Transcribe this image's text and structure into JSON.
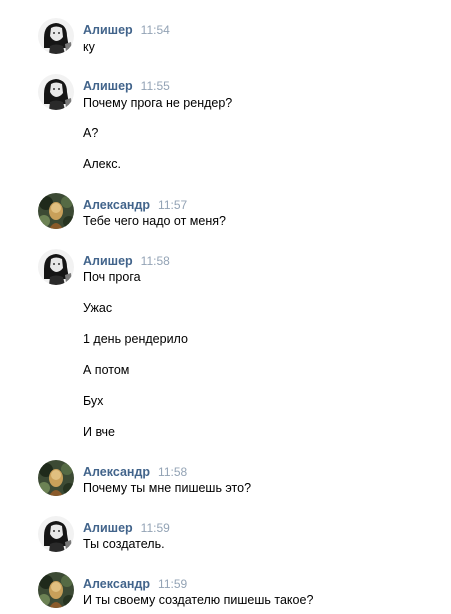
{
  "messages": [
    {
      "author": "Алишер",
      "time": "11:54",
      "avatar": "alisher",
      "lines": [
        "ку"
      ]
    },
    {
      "author": "Алишер",
      "time": "11:55",
      "avatar": "alisher",
      "lines": [
        "Почему прога не рендер?",
        "А?",
        "Алекс."
      ]
    },
    {
      "author": "Александр",
      "time": "11:57",
      "avatar": "alexander",
      "lines": [
        "Тебе чего надо от меня?"
      ]
    },
    {
      "author": "Алишер",
      "time": "11:58",
      "avatar": "alisher",
      "lines": [
        "Поч прога",
        "Ужас",
        "1 день рендерило",
        "А потом",
        "Бух",
        "И вче"
      ]
    },
    {
      "author": "Александр",
      "time": "11:58",
      "avatar": "alexander",
      "lines": [
        "Почему ты мне пишешь это?"
      ]
    },
    {
      "author": "Алишер",
      "time": "11:59",
      "avatar": "alisher",
      "lines": [
        "Ты создатель."
      ]
    },
    {
      "author": "Александр",
      "time": "11:59",
      "avatar": "alexander",
      "lines": [
        "И ты своему создателю пишешь такое?"
      ]
    }
  ],
  "colors": {
    "author": "#42648b",
    "time": "#93a3b5",
    "text": "#000000",
    "background": "#ffffff"
  }
}
